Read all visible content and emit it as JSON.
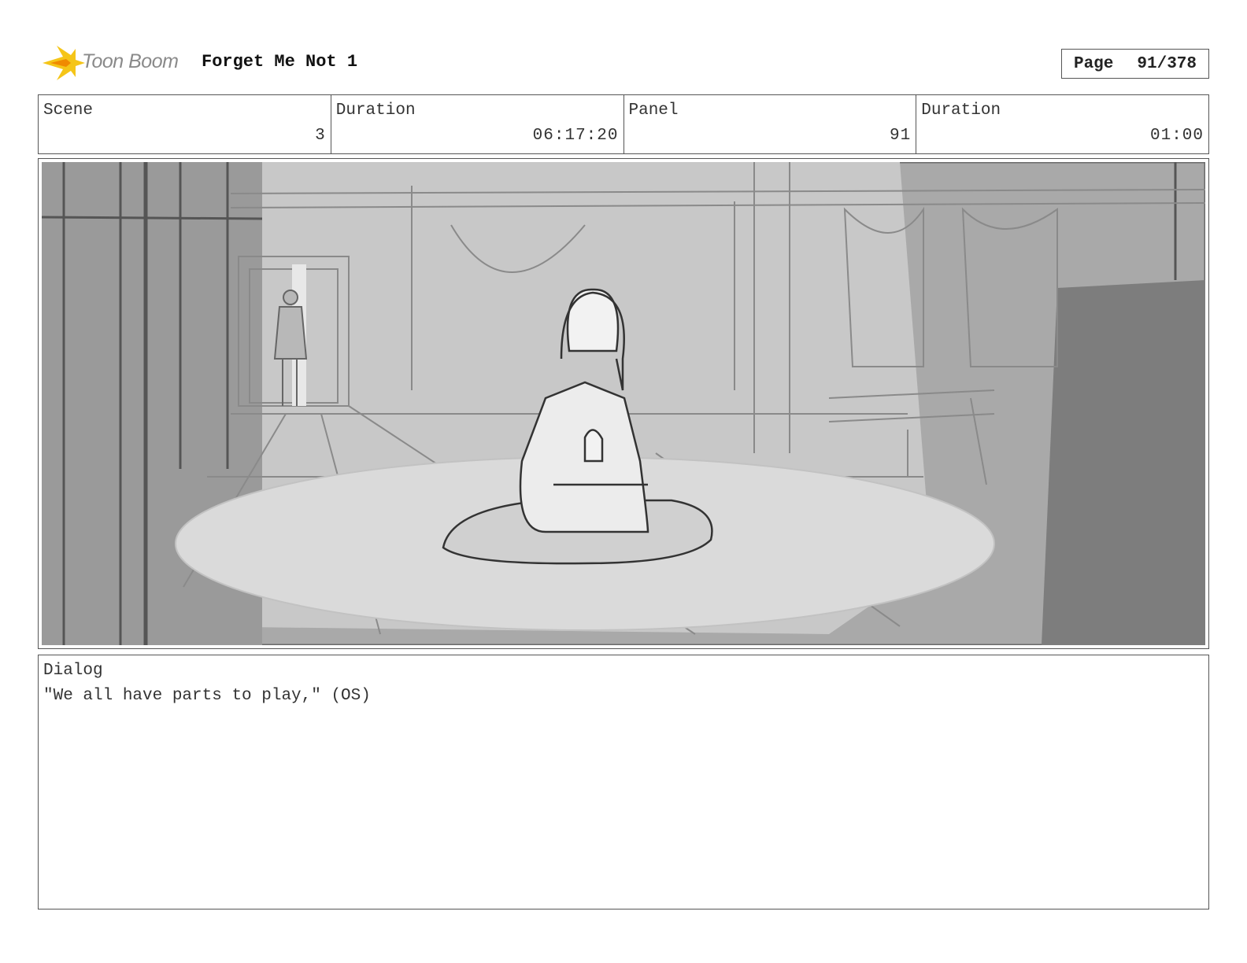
{
  "header": {
    "logo_text": "Toon Boom",
    "project_title": "Forget Me Not 1",
    "page_label": "Page",
    "page_value": "91/378"
  },
  "info": {
    "scene_label": "Scene",
    "scene_value": "3",
    "scene_duration_label": "Duration",
    "scene_duration_value": "06:17:20",
    "panel_label": "Panel",
    "panel_value": "91",
    "panel_duration_label": "Duration",
    "panel_duration_value": "01:00"
  },
  "dialog": {
    "label": "Dialog",
    "text": "\"We all have parts to play,\" (OS)"
  },
  "colors": {
    "logo_flame": "#f5c518",
    "sketch_dark": "#555555",
    "sketch_light": "#e2e2e2"
  }
}
